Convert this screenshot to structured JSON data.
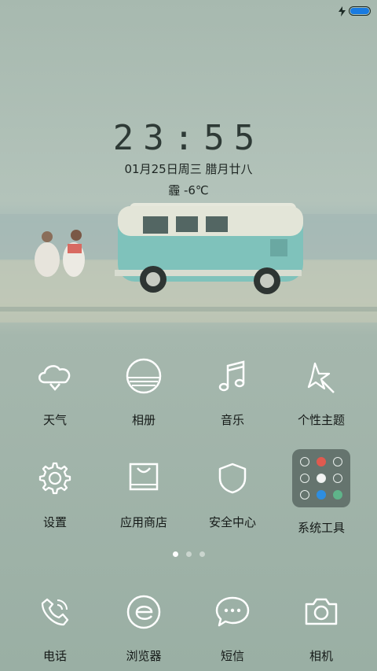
{
  "status_bar": {
    "battery_color": "#1a7be0",
    "battery_level": 1.0,
    "charging": true
  },
  "lockwidget": {
    "time": "23:55",
    "date": "01月25日周三 腊月廿八",
    "weather": "霾  -6℃"
  },
  "apps": [
    {
      "label": "天气",
      "icon": "cloud-weather-icon"
    },
    {
      "label": "相册",
      "icon": "sunset-album-icon"
    },
    {
      "label": "音乐",
      "icon": "music-note-icon"
    },
    {
      "label": "个性主题",
      "icon": "magic-star-icon"
    },
    {
      "label": "设置",
      "icon": "gear-icon"
    },
    {
      "label": "应用商店",
      "icon": "shopping-bag-icon"
    },
    {
      "label": "安全中心",
      "icon": "shield-icon"
    },
    {
      "label": "系统工具",
      "icon": "folder-icon"
    }
  ],
  "pager": {
    "count": 3,
    "active": 1
  },
  "dock": [
    {
      "label": "电话",
      "icon": "phone-icon"
    },
    {
      "label": "浏览器",
      "icon": "browser-e-icon"
    },
    {
      "label": "短信",
      "icon": "message-bubble-icon"
    },
    {
      "label": "相机",
      "icon": "camera-icon"
    }
  ],
  "colors": {
    "wallpaper": "#9fb3a8",
    "van": "#7fc2bb",
    "folder_bg": "#5a6964"
  }
}
